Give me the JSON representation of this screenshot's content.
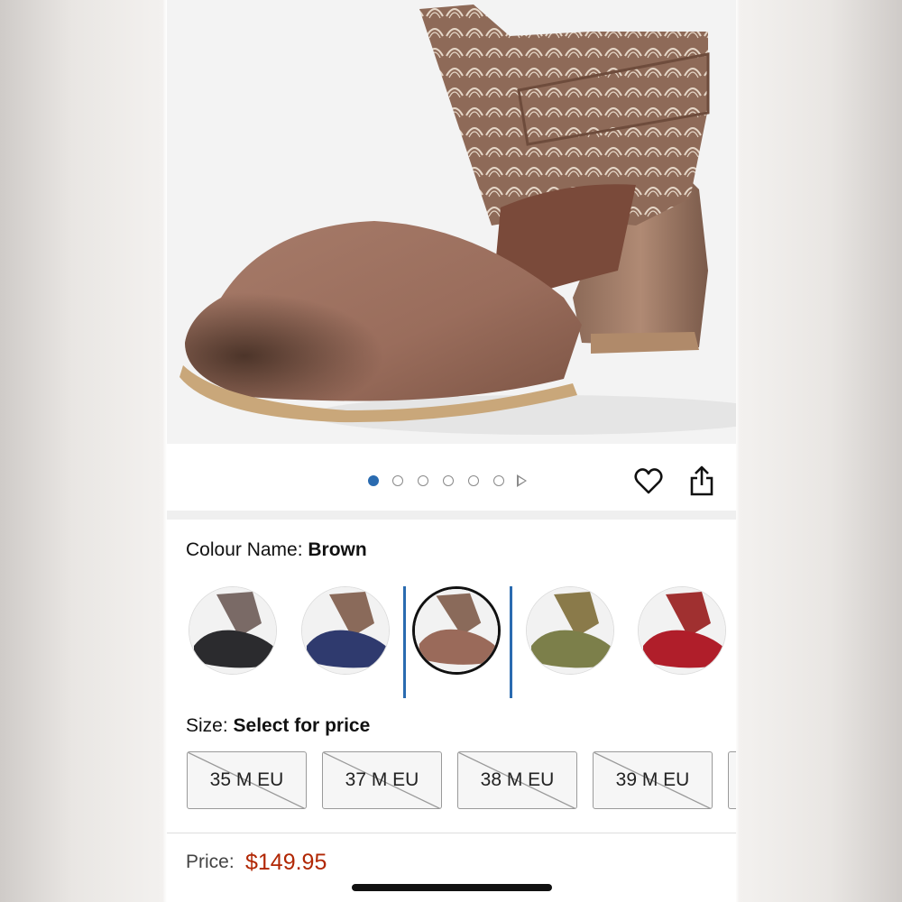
{
  "gallery": {
    "total_pages": 6,
    "current_page": 1,
    "has_video": true,
    "icons": [
      "heart-icon",
      "share-icon",
      "play-icon"
    ]
  },
  "colour": {
    "label": "Colour Name: ",
    "value": "Brown",
    "options": [
      {
        "name": "black",
        "color": "#2b2b2e"
      },
      {
        "name": "navy",
        "color": "#2f3a6e"
      },
      {
        "name": "brown",
        "color": "#9a6a5a",
        "selected": true
      },
      {
        "name": "olive",
        "color": "#7c7f4a"
      },
      {
        "name": "red",
        "color": "#b01e2a"
      }
    ]
  },
  "size": {
    "label": "Size: ",
    "value": "Select for price",
    "options": [
      {
        "label": "35 M EU",
        "available": false
      },
      {
        "label": "37 M EU",
        "available": false
      },
      {
        "label": "38 M EU",
        "available": false
      },
      {
        "label": "39 M EU",
        "available": false
      }
    ]
  },
  "price": {
    "label": "Price:",
    "value": "$149.95"
  },
  "colors": {
    "accent": "#2a6bb0",
    "price": "#b12704"
  }
}
